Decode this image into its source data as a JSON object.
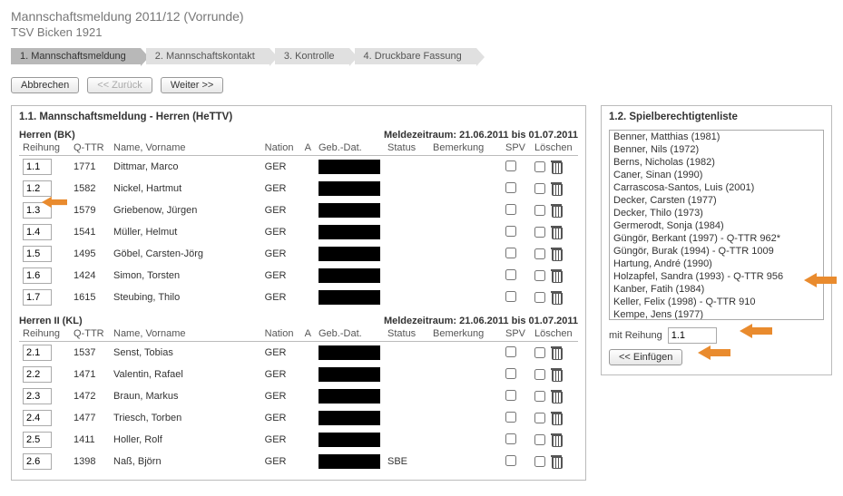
{
  "page": {
    "title": "Mannschaftsmeldung 2011/12 (Vorrunde)",
    "subtitle": "TSV Bicken 1921"
  },
  "steps": [
    {
      "label": "1.  Mannschaftsmeldung",
      "active": true
    },
    {
      "label": "2.  Mannschaftskontakt",
      "active": false
    },
    {
      "label": "3.  Kontrolle",
      "active": false
    },
    {
      "label": "4.  Druckbare Fassung",
      "active": false
    }
  ],
  "buttons": {
    "cancel": "Abbrechen",
    "back": "<< Zurück",
    "next": "Weiter >>",
    "insert": "<< Einfügen"
  },
  "left_panel_title": "1.1. Mannschaftsmeldung - Herren (HeTTV)",
  "right_panel_title": "1.2. Spielberechtigtenliste",
  "columns": {
    "reihung": "Reihung",
    "qttr": "Q-TTR",
    "name": "Name, Vorname",
    "nation": "Nation",
    "a": "A",
    "geb": "Geb.-Dat.",
    "status": "Status",
    "bemerkung": "Bemerkung",
    "spv": "SPV",
    "loeschen": "Löschen"
  },
  "teams": [
    {
      "name": "Herren (BK)",
      "meldezeitraum": "Meldezeitraum:  21.06.2011 bis 01.07.2011",
      "rows": [
        {
          "rank": "1.1",
          "qttr": "1771",
          "name": "Dittmar, Marco",
          "nation": "GER",
          "status": "",
          "bem": ""
        },
        {
          "rank": "1.2",
          "qttr": "1582",
          "name": "Nickel, Hartmut",
          "nation": "GER",
          "status": "",
          "bem": ""
        },
        {
          "rank": "1.3",
          "qttr": "1579",
          "name": "Griebenow, Jürgen",
          "nation": "GER",
          "status": "",
          "bem": ""
        },
        {
          "rank": "1.4",
          "qttr": "1541",
          "name": "Müller, Helmut",
          "nation": "GER",
          "status": "",
          "bem": ""
        },
        {
          "rank": "1.5",
          "qttr": "1495",
          "name": "Göbel, Carsten-Jörg",
          "nation": "GER",
          "status": "",
          "bem": ""
        },
        {
          "rank": "1.6",
          "qttr": "1424",
          "name": "Simon, Torsten",
          "nation": "GER",
          "status": "",
          "bem": ""
        },
        {
          "rank": "1.7",
          "qttr": "1615",
          "name": "Steubing, Thilo",
          "nation": "GER",
          "status": "",
          "bem": ""
        }
      ]
    },
    {
      "name": "Herren II (KL)",
      "meldezeitraum": "Meldezeitraum:  21.06.2011 bis 01.07.2011",
      "rows": [
        {
          "rank": "2.1",
          "qttr": "1537",
          "name": "Senst, Tobias",
          "nation": "GER",
          "status": "",
          "bem": ""
        },
        {
          "rank": "2.2",
          "qttr": "1471",
          "name": "Valentin, Rafael",
          "nation": "GER",
          "status": "",
          "bem": ""
        },
        {
          "rank": "2.3",
          "qttr": "1472",
          "name": "Braun, Markus",
          "nation": "GER",
          "status": "",
          "bem": ""
        },
        {
          "rank": "2.4",
          "qttr": "1477",
          "name": "Triesch, Torben",
          "nation": "GER",
          "status": "",
          "bem": ""
        },
        {
          "rank": "2.5",
          "qttr": "1411",
          "name": "Holler, Rolf",
          "nation": "GER",
          "status": "",
          "bem": ""
        },
        {
          "rank": "2.6",
          "qttr": "1398",
          "name": "Naß, Björn",
          "nation": "GER",
          "status": "SBE",
          "bem": ""
        }
      ]
    }
  ],
  "eligible": [
    "Benner, Matthias (1981)",
    "Benner, Nils (1972)",
    "Berns, Nicholas (1982)",
    "Caner, Sinan (1990)",
    "Carrascosa-Santos, Luis (2001)",
    "Decker, Carsten (1977)",
    "Decker, Thilo (1973)",
    "Germerodt, Sonja (1984)",
    "Güngör, Berkant (1997) - Q-TTR 962*",
    "Güngör, Burak (1994) - Q-TTR 1009",
    "Hartung, André (1990)",
    "Holzapfel, Sandra (1993) - Q-TTR 956",
    "Kanber, Fatih (1984)",
    "Keller, Felix (1998) - Q-TTR 910",
    "Kempe, Jens (1977)"
  ],
  "with_rank_label": "mit Reihung",
  "with_rank_value": "1.1"
}
